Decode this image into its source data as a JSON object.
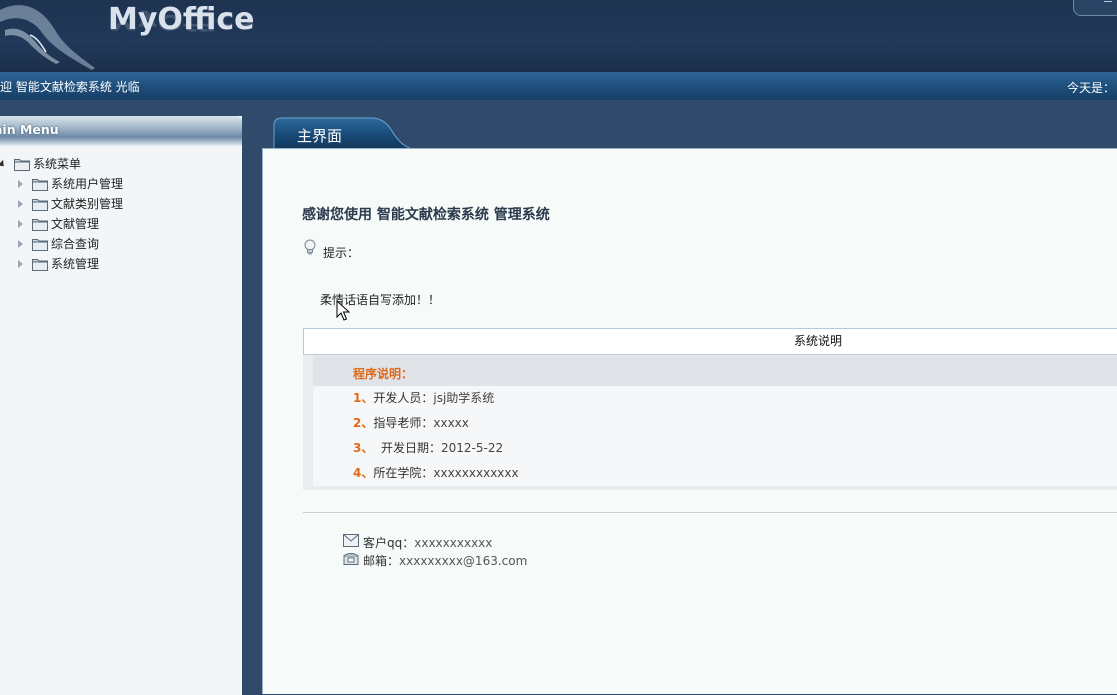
{
  "header": {
    "brand": "MyOffice",
    "brand_reflection": "MyOffice"
  },
  "welcome_bar": {
    "left_text": "迎  智能文献检索系统  光临",
    "right_text": "今天是："
  },
  "sidebar": {
    "title": "ain Menu",
    "root": {
      "label": "系统菜单",
      "icon": "folder-icon"
    },
    "items": [
      {
        "label": "系统用户管理",
        "icon": "folder-icon"
      },
      {
        "label": "文献类别管理",
        "icon": "folder-icon"
      },
      {
        "label": "文献管理",
        "icon": "folder-icon"
      },
      {
        "label": "综合查询",
        "icon": "folder-icon"
      },
      {
        "label": "系统管理",
        "icon": "folder-icon"
      }
    ]
  },
  "tab": {
    "label": "主界面"
  },
  "main": {
    "heading": "感谢您使用  智能文献检索系统  管理系统",
    "tip_label": "提示：",
    "motto": "柔情话语自写添加！！",
    "info_header": "系统说明",
    "info_title": "程序说明：",
    "rows": [
      {
        "num": "1、",
        "label": "开发人员：",
        "value": "jsj助学系统"
      },
      {
        "num": "2、",
        "label": "指导老师：",
        "value": "xxxxx"
      },
      {
        "num": "3、",
        "label": "  开发日期：",
        "value": "2012-5-22"
      },
      {
        "num": "4、",
        "label": "所在学院：",
        "value": "xxxxxxxxxxxx"
      }
    ],
    "contacts": [
      {
        "icon": "envelope-icon",
        "label": "客户qq：",
        "value": "xxxxxxxxxxx"
      },
      {
        "icon": "phone-icon",
        "label": "邮箱：",
        "value": "xxxxxxxxx@163.com"
      }
    ]
  },
  "colors": {
    "header_bg": "#1d3350",
    "welcome_bar": "#1f4f7d",
    "accent_orange": "#e06a1a",
    "panel_bg": "#f6faf9"
  }
}
